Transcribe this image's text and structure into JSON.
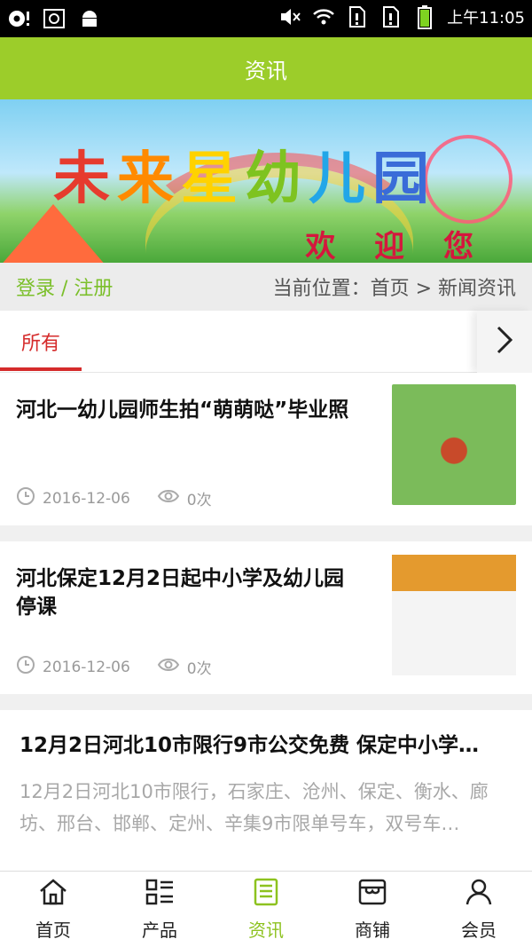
{
  "status_bar": {
    "time": "上午11:05",
    "icons": [
      "notification-icon",
      "screenshot-icon",
      "android-icon",
      "mute-icon",
      "wifi-icon",
      "sim1-icon",
      "sim2-icon",
      "battery-icon"
    ]
  },
  "appbar": {
    "title": "资讯"
  },
  "banner": {
    "title_chars": [
      "未",
      "来",
      "星",
      "幼",
      "儿",
      "园"
    ],
    "welcome": "欢 迎 您"
  },
  "crumbbar": {
    "login_label": "登录 / 注册",
    "location_label": "当前位置：首页 > 新闻资讯"
  },
  "tabs": {
    "active": "所有",
    "more_icon": "chevron-right-icon"
  },
  "articles": [
    {
      "title": "河北一幼儿园师生拍“萌萌哒”毕业照",
      "date": "2016-12-06",
      "views": "0次"
    },
    {
      "title": "河北保定12月2日起中小学及幼儿园停课",
      "date": "2016-12-06",
      "views": "0次"
    },
    {
      "title": "12月2日河北10市限行9市公交免费 保定中小学…",
      "desc": "12月2日河北10市限行，石家庄、沧州、保定、衡水、廊坊、邢台、邯郸、定州、辛集9市限单号车，双号车…"
    }
  ],
  "nav": {
    "items": [
      {
        "label": "首页",
        "icon": "home-icon"
      },
      {
        "label": "产品",
        "icon": "grid-list-icon"
      },
      {
        "label": "资讯",
        "icon": "news-icon"
      },
      {
        "label": "商铺",
        "icon": "shop-icon"
      },
      {
        "label": "会员",
        "icon": "user-icon"
      }
    ],
    "active_index": 2
  },
  "colors": {
    "accent": "#9ccd2a",
    "tab_active": "#d52b2b",
    "nav_active": "#8dc21f"
  }
}
